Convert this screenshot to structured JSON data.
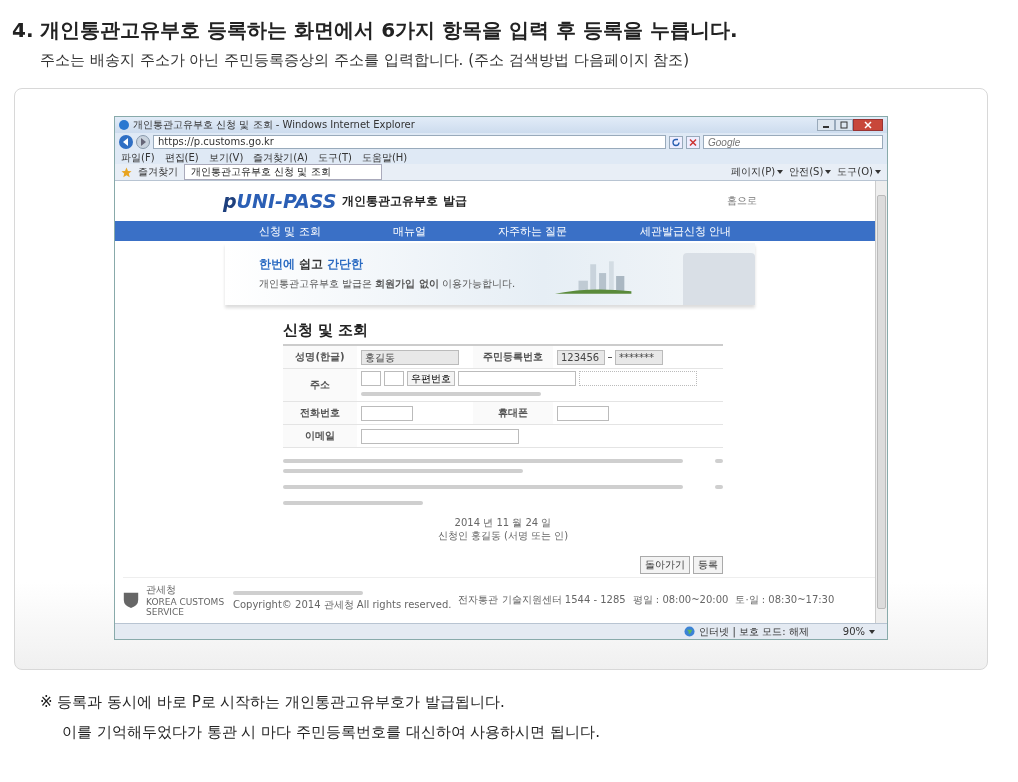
{
  "heading": "4. 개인통관고유부호 등록하는 화면에서 6가지 항목을 입력 후 등록을 누릅니다.",
  "subheading": "주소는 배송지 주소가 아닌 주민등록증상의 주소를 입력합니다. (주소 검색방법 다음페이지 참조)",
  "browser": {
    "title": "개인통관고유부호 신청 및 조회 - Windows Internet Explorer",
    "url": "https://p.customs.go.kr",
    "search_placeholder": "Google",
    "menu": [
      "파일(F)",
      "편집(E)",
      "보기(V)",
      "즐겨찾기(A)",
      "도구(T)",
      "도움말(H)"
    ],
    "favorites": "즐겨찾기",
    "tab": "개인통관고유부호 신청 및 조회",
    "tools": [
      "페이지(P)",
      "안전(S)",
      "도구(O)"
    ],
    "status": "인터넷 | 보호 모드: 해제",
    "zoom": "90%"
  },
  "site": {
    "logo_prefix": "p",
    "logo": "UNI-PASS",
    "title": "개인통관고유부호 발급",
    "home": "홈으로",
    "nav": [
      "신청 및 조회",
      "매뉴얼",
      "자주하는 질문",
      "세관발급신청 안내"
    ],
    "banner": {
      "headline": [
        {
          "text": "한번에",
          "accent": true
        },
        {
          "text": "쉽고",
          "accent": false
        },
        {
          "text": "간단한",
          "accent": true
        }
      ],
      "text": "개인통관고유부호 발급은 **회원가입 없이** 이용가능합니다."
    },
    "form": {
      "title": "신청 및 조회",
      "name_label": "성명(한글)",
      "name_value": "홍길동",
      "id_label": "주민등록번호",
      "id_values": [
        "123456",
        "*******"
      ],
      "address_label": "주소",
      "zip_button": "우편번호",
      "phone_label": "전화번호",
      "mobile_label": "휴대폰",
      "email_label": "이메일"
    },
    "date": "2014 년 11 월 24 일",
    "signer": "신청인   홍길동 (서명 또는 인)",
    "buttons": [
      "돌아가기",
      "등록"
    ],
    "footer": {
      "org": "관세청",
      "org_en": "KOREA CUSTOMS SERVICE",
      "copyright": "Copyright© 2014 관세청 All rights reserved.",
      "support": "전자통관 기술지원센터 1544 - 1285",
      "weekday": "평일 : 08:00~20:00",
      "weekend": "토·일 : 08:30~17:30"
    }
  },
  "notes": [
    "※ 등록과 동시에 바로 P로 시작하는 개인통관고유부호가 발급됩니다.",
    "이를 기억해두었다가 통관 시 마다 주민등록번호를 대신하여 사용하시면 됩니다."
  ]
}
